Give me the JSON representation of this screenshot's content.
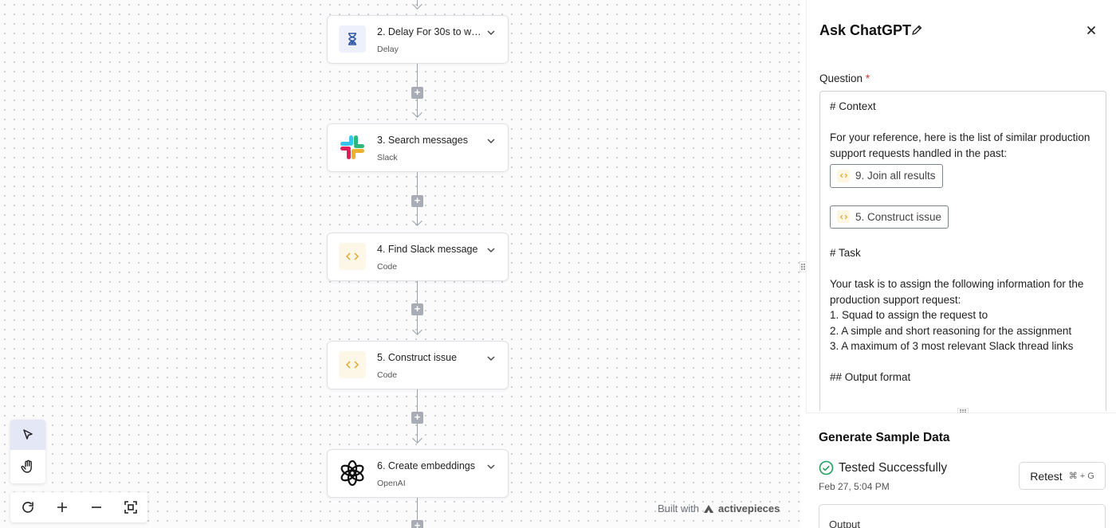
{
  "steps": [
    {
      "title": "2. Delay For 30s to wai...",
      "subtitle": "Delay",
      "icon": "hourglass-icon"
    },
    {
      "title": "3. Search messages",
      "subtitle": "Slack",
      "icon": "slack-logo-icon"
    },
    {
      "title": "4. Find Slack message",
      "subtitle": "Code",
      "icon": "code-icon"
    },
    {
      "title": "5. Construct issue",
      "subtitle": "Code",
      "icon": "code-icon"
    },
    {
      "title": "6. Create embeddings",
      "subtitle": "OpenAI",
      "icon": "openai-logo-icon"
    }
  ],
  "canvas": {
    "built_with": "Built with",
    "brand": "activepieces"
  },
  "panel": {
    "title": "Ask ChatGPT",
    "question_label": "Question",
    "required_mark": "*",
    "question_lines": {
      "l1": "# Context",
      "l2": "For your reference, here is the list of similar production support requests handled in the past:",
      "chip1": "9. Join all results",
      "chip2": "5. Construct issue",
      "l3": "# Task",
      "l4": "Your task is to assign the following information for the production support request:",
      "l5": "1. Squad to assign the request to",
      "l6": "2. A simple and short reasoning for the assignment",
      "l7": "3. A maximum of 3 most relevant Slack thread links",
      "l8": "## Output format"
    }
  },
  "sample": {
    "title": "Generate Sample Data",
    "status": "Tested Successfully",
    "date": "Feb 27, 5:04 PM",
    "retest_label": "Retest",
    "retest_shortcut": "⌘ + G",
    "output_label": "Output"
  },
  "colors": {
    "accent_green": "#1e9e5a",
    "code_orange": "#e0a526",
    "delay_blue": "#2f55a4"
  }
}
